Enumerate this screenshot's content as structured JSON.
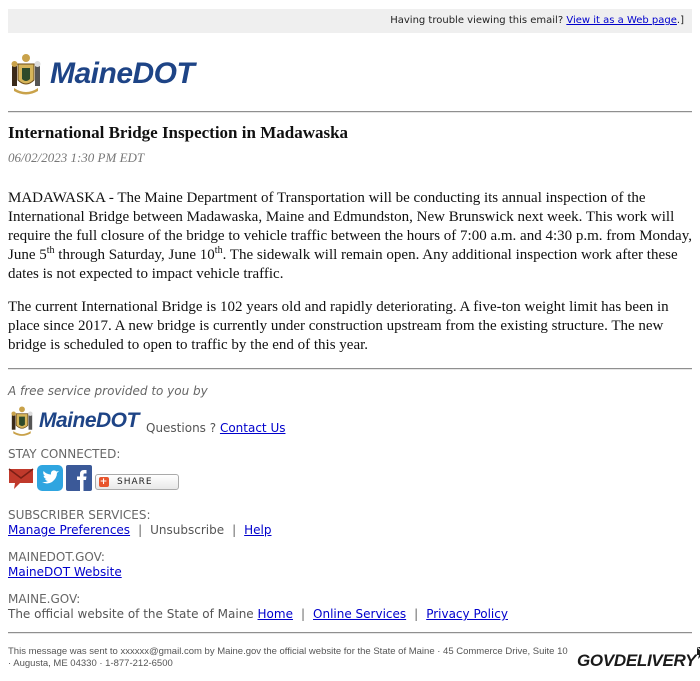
{
  "topbar": {
    "trouble_text": "Having trouble viewing this email?",
    "view_link": "View it as a Web page",
    "trailing": ".]"
  },
  "header": {
    "logo_text": "MaineDOT",
    "logo_icon": "maine-state-seal"
  },
  "article": {
    "title": "International Bridge Inspection in Madawaska",
    "date": "06/02/2023 1:30 PM EDT",
    "p1_a": "MADAWASKA - The Maine Department of Transportation will be conducting its annual inspection of the International Bridge between Madawaska, Maine and Edmundston, New Brunswick next week. This work will require the full closure of the bridge to vehicle traffic between the hours of 7:00 a.m. and 4:30 p.m. from Monday, June 5",
    "p1_sup1": "th",
    "p1_b": " through Saturday, June 10",
    "p1_sup2": "th",
    "p1_c": ". The sidewalk will remain open. Any additional inspection work after these dates is not expected to impact vehicle traffic.",
    "p2": "The current International Bridge is 102 years old and rapidly deteriorating. A five-ton weight limit has been in place since 2017. A new bridge is currently under construction upstream from the existing structure. The new bridge is scheduled to open to traffic by the end of this year."
  },
  "footer": {
    "free_service": "A free service provided to you by",
    "logo_text": "MaineDOT",
    "questions": "Questions ?",
    "contact_link": "Contact Us",
    "stay_connected": "STAY CONNECTED:",
    "social": [
      {
        "name": "email-icon",
        "color": "#c0392b"
      },
      {
        "name": "twitter-icon",
        "color": "#2fa5e0"
      },
      {
        "name": "facebook-icon",
        "color": "#3b5998"
      }
    ],
    "share_label": "SHARE",
    "subscriber_label": "SUBSCRIBER SERVICES:",
    "manage_link": "Manage Preferences",
    "unsubscribe": "Unsubscribe",
    "help_link": "Help",
    "mainedot_label": "MAINEDOT.GOV:",
    "mainedot_link": "MaineDOT Website",
    "mainegov_label": "MAINE.GOV:",
    "official_text": "The official website of the State of Maine",
    "home_link": "Home",
    "online_link": "Online Services",
    "privacy_link": "Privacy Policy",
    "sep": "|",
    "bottom_message": "This message was sent to xxxxxx@gmail.com by Maine.gov the official website for the State of Maine · 45 Commerce Drive, Suite 10 · Augusta, ME 04330 · 1-877-212-6500",
    "govdelivery": "GOVDELIVERY"
  },
  "colors": {
    "brand_blue": "#1e4486",
    "link": "#0000cc",
    "topbar_bg": "#efefef"
  }
}
